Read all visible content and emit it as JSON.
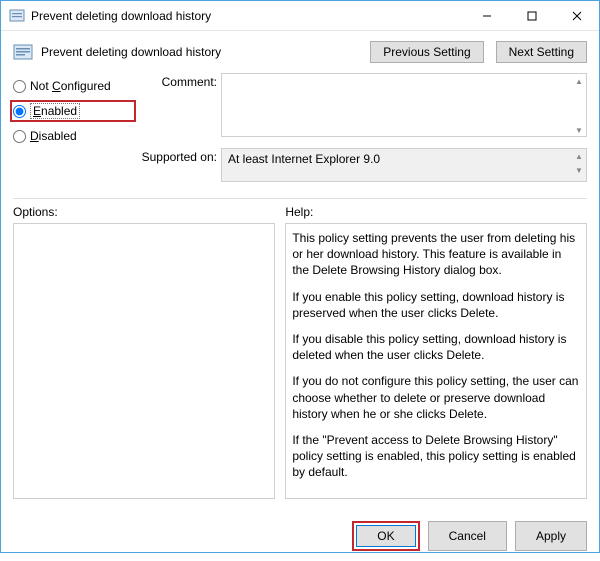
{
  "window": {
    "title": "Prevent deleting download history"
  },
  "header": {
    "title": "Prevent deleting download history",
    "prev": "Previous Setting",
    "next": "Next Setting"
  },
  "radios": {
    "not_configured": "Not Configured",
    "enabled": "Enabled",
    "disabled": "Disabled",
    "selected": "enabled"
  },
  "labels": {
    "comment": "Comment:",
    "supported": "Supported on:",
    "options": "Options:",
    "help": "Help:"
  },
  "comment_value": "",
  "supported_value": "At least Internet Explorer 9.0",
  "help": {
    "p1": "This policy setting prevents the user from deleting his or her download history. This feature is available in the Delete Browsing History dialog box.",
    "p2": "If you enable this policy setting, download history is preserved when the user clicks Delete.",
    "p3": "If you disable this policy setting, download history is deleted when the user clicks Delete.",
    "p4": "If you do not configure this policy setting, the user can choose whether to delete or preserve download history when he or she clicks Delete.",
    "p5": "If the \"Prevent access to Delete Browsing History\" policy setting is enabled, this policy setting is enabled by default."
  },
  "footer": {
    "ok": "OK",
    "cancel": "Cancel",
    "apply": "Apply"
  }
}
